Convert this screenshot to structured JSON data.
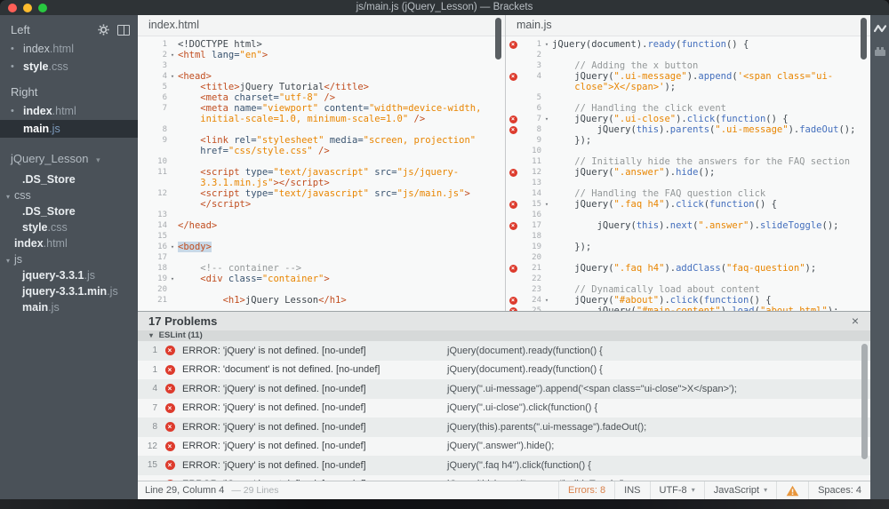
{
  "title_bar": {
    "title": "js/main.js (jQuery_Lesson) — Brackets"
  },
  "icons": {
    "dot": "•",
    "caret_down": "▾",
    "error_x": "×",
    "close": "×"
  },
  "colors": {
    "error_red": "#dd3b2d",
    "string_orange": "#e88501",
    "keyword_blue": "#446fbd",
    "tag_orange": "#c14e20",
    "warning_orange": "#e8963c"
  },
  "sidebar": {
    "working_sets": [
      {
        "label": "Left",
        "items": [
          {
            "base": "index",
            "ext": ".html",
            "dot": true,
            "bold": false,
            "selected": false
          },
          {
            "base": "style",
            "ext": ".css",
            "dot": true,
            "bold": true,
            "selected": false
          }
        ]
      },
      {
        "label": "Right",
        "items": [
          {
            "base": "index",
            "ext": ".html",
            "dot": true,
            "bold": true,
            "selected": false
          },
          {
            "base": "main",
            "ext": ".js",
            "dot": false,
            "bold": true,
            "selected": true
          }
        ]
      }
    ],
    "project": {
      "name": "jQuery_Lesson"
    },
    "tree": [
      {
        "type": "file",
        "base": ".DS_Store",
        "ext": "",
        "indent": 25
      },
      {
        "type": "folder",
        "base": "css",
        "indent": 7
      },
      {
        "type": "file",
        "base": ".DS_Store",
        "ext": "",
        "indent": 25
      },
      {
        "type": "file",
        "base": "style",
        "ext": ".css",
        "indent": 25
      },
      {
        "type": "file",
        "base": "index",
        "ext": ".html",
        "indent": 16
      },
      {
        "type": "folder",
        "base": "js",
        "indent": 7
      },
      {
        "type": "file",
        "base": "jquery-3.3.1",
        "ext": ".js",
        "indent": 25
      },
      {
        "type": "file",
        "base": "jquery-3.3.1.min",
        "ext": ".js",
        "indent": 25
      },
      {
        "type": "file",
        "base": "main",
        "ext": ".js",
        "indent": 25
      }
    ]
  },
  "editors": {
    "left": {
      "tab": "index.html",
      "rows": [
        {
          "n": "1",
          "toks": [
            [
              "pl",
              "<!DOCTYPE html>"
            ]
          ]
        },
        {
          "n": "2",
          "fold": true,
          "toks": [
            [
              "tg",
              "<html "
            ],
            [
              "at",
              "lang="
            ],
            [
              "st",
              "\"en\""
            ],
            [
              "tg",
              ">"
            ]
          ]
        },
        {
          "n": "3",
          "toks": []
        },
        {
          "n": "4",
          "fold": true,
          "toks": [
            [
              "tg",
              "<head>"
            ]
          ]
        },
        {
          "n": "5",
          "toks": [
            [
              "pl",
              "    "
            ],
            [
              "tg",
              "<title>"
            ],
            [
              "pl",
              "jQuery Tutorial"
            ],
            [
              "tg",
              "</title>"
            ]
          ]
        },
        {
          "n": "6",
          "toks": [
            [
              "pl",
              "    "
            ],
            [
              "tg",
              "<meta "
            ],
            [
              "at",
              "charset="
            ],
            [
              "st",
              "\"utf-8\""
            ],
            [
              "tg",
              " />"
            ]
          ]
        },
        {
          "n": "7",
          "toks": [
            [
              "pl",
              "    "
            ],
            [
              "tg",
              "<meta "
            ],
            [
              "at",
              "name="
            ],
            [
              "st",
              "\"viewport\""
            ],
            [
              "pl",
              " "
            ],
            [
              "at",
              "content="
            ],
            [
              "st",
              "\"width=device-width,"
            ]
          ]
        },
        {
          "n": "",
          "toks": [
            [
              "pl",
              "    "
            ],
            [
              "st",
              "initial-scale=1.0, minimum-scale=1.0\""
            ],
            [
              "tg",
              " />"
            ]
          ]
        },
        {
          "n": "8",
          "toks": []
        },
        {
          "n": "9",
          "toks": [
            [
              "pl",
              "    "
            ],
            [
              "tg",
              "<link "
            ],
            [
              "at",
              "rel="
            ],
            [
              "st",
              "\"stylesheet\""
            ],
            [
              "pl",
              " "
            ],
            [
              "at",
              "media="
            ],
            [
              "st",
              "\"screen, projection\""
            ]
          ]
        },
        {
          "n": "",
          "toks": [
            [
              "pl",
              "    "
            ],
            [
              "at",
              "href="
            ],
            [
              "st",
              "\"css/style.css\""
            ],
            [
              "tg",
              " />"
            ]
          ]
        },
        {
          "n": "10",
          "toks": []
        },
        {
          "n": "11",
          "toks": [
            [
              "pl",
              "    "
            ],
            [
              "tg",
              "<script "
            ],
            [
              "at",
              "type="
            ],
            [
              "st",
              "\"text/javascript\""
            ],
            [
              "pl",
              " "
            ],
            [
              "at",
              "src="
            ],
            [
              "st",
              "\"js/jquery-"
            ]
          ]
        },
        {
          "n": "",
          "toks": [
            [
              "pl",
              "    "
            ],
            [
              "st",
              "3.3.1.min.js\""
            ],
            [
              "tg",
              "></script>"
            ]
          ]
        },
        {
          "n": "12",
          "toks": [
            [
              "pl",
              "    "
            ],
            [
              "tg",
              "<script "
            ],
            [
              "at",
              "type="
            ],
            [
              "st",
              "\"text/javascript\""
            ],
            [
              "pl",
              " "
            ],
            [
              "at",
              "src="
            ],
            [
              "st",
              "\"js/main.js\""
            ],
            [
              "tg",
              ">"
            ]
          ]
        },
        {
          "n": "",
          "toks": [
            [
              "pl",
              "    "
            ],
            [
              "tg",
              "</script>"
            ]
          ]
        },
        {
          "n": "13",
          "toks": []
        },
        {
          "n": "14",
          "toks": [
            [
              "tg",
              "</head>"
            ]
          ]
        },
        {
          "n": "15",
          "toks": []
        },
        {
          "n": "16",
          "fold": true,
          "toks": [
            [
              "hl",
              "<body>"
            ]
          ]
        },
        {
          "n": "17",
          "toks": []
        },
        {
          "n": "18",
          "toks": [
            [
              "pl",
              "    "
            ],
            [
              "cm",
              "<!-- container -->"
            ]
          ]
        },
        {
          "n": "19",
          "fold": true,
          "toks": [
            [
              "pl",
              "    "
            ],
            [
              "tg",
              "<div "
            ],
            [
              "at",
              "class="
            ],
            [
              "st",
              "\"container\""
            ],
            [
              "tg",
              ">"
            ]
          ]
        },
        {
          "n": "20",
          "toks": []
        },
        {
          "n": "21",
          "toks": [
            [
              "pl",
              "        "
            ],
            [
              "tg",
              "<h1>"
            ],
            [
              "pl",
              "jQuery Lesson"
            ],
            [
              "tg",
              "</h1>"
            ]
          ]
        }
      ]
    },
    "right": {
      "tab": "main.js",
      "rows": [
        {
          "n": "1",
          "fold": true,
          "err": true,
          "toks": [
            [
              "pl",
              "jQuery(document)."
            ],
            [
              "pr",
              "ready"
            ],
            [
              "pl",
              "("
            ],
            [
              "kw",
              "function"
            ],
            [
              "pl",
              "() {"
            ]
          ]
        },
        {
          "n": "2",
          "toks": []
        },
        {
          "n": "3",
          "toks": [
            [
              "pl",
              "    "
            ],
            [
              "cm",
              "// Adding the x button"
            ]
          ]
        },
        {
          "n": "4",
          "err": true,
          "toks": [
            [
              "pl",
              "    jQuery("
            ],
            [
              "st",
              "\".ui-message\""
            ],
            [
              "pl",
              ")."
            ],
            [
              "pr",
              "append"
            ],
            [
              "pl",
              "("
            ],
            [
              "st",
              "'<span class=\"ui-"
            ]
          ]
        },
        {
          "n": "",
          "toks": [
            [
              "pl",
              "    "
            ],
            [
              "st",
              "close\">X</span>'"
            ],
            [
              "pl",
              ");"
            ]
          ]
        },
        {
          "n": "5",
          "toks": []
        },
        {
          "n": "6",
          "toks": [
            [
              "pl",
              "    "
            ],
            [
              "cm",
              "// Handling the click event"
            ]
          ]
        },
        {
          "n": "7",
          "fold": true,
          "err": true,
          "toks": [
            [
              "pl",
              "    jQuery("
            ],
            [
              "st",
              "\".ui-close\""
            ],
            [
              "pl",
              ")."
            ],
            [
              "pr",
              "click"
            ],
            [
              "pl",
              "("
            ],
            [
              "kw",
              "function"
            ],
            [
              "pl",
              "() {"
            ]
          ]
        },
        {
          "n": "8",
          "err": true,
          "toks": [
            [
              "pl",
              "        jQuery("
            ],
            [
              "kw",
              "this"
            ],
            [
              "pl",
              ")."
            ],
            [
              "pr",
              "parents"
            ],
            [
              "pl",
              "("
            ],
            [
              "st",
              "\".ui-message\""
            ],
            [
              "pl",
              ")."
            ],
            [
              "pr",
              "fadeOut"
            ],
            [
              "pl",
              "();"
            ]
          ]
        },
        {
          "n": "9",
          "toks": [
            [
              "pl",
              "    });"
            ]
          ]
        },
        {
          "n": "10",
          "toks": []
        },
        {
          "n": "11",
          "toks": [
            [
              "pl",
              "    "
            ],
            [
              "cm",
              "// Initially hide the answers for the FAQ section"
            ]
          ]
        },
        {
          "n": "12",
          "err": true,
          "toks": [
            [
              "pl",
              "    jQuery("
            ],
            [
              "st",
              "\".answer\""
            ],
            [
              "pl",
              ")."
            ],
            [
              "pr",
              "hide"
            ],
            [
              "pl",
              "();"
            ]
          ]
        },
        {
          "n": "13",
          "toks": []
        },
        {
          "n": "14",
          "toks": [
            [
              "pl",
              "    "
            ],
            [
              "cm",
              "// Handling the FAQ question click"
            ]
          ]
        },
        {
          "n": "15",
          "fold": true,
          "err": true,
          "toks": [
            [
              "pl",
              "    jQuery("
            ],
            [
              "st",
              "\".faq h4\""
            ],
            [
              "pl",
              ")."
            ],
            [
              "pr",
              "click"
            ],
            [
              "pl",
              "("
            ],
            [
              "kw",
              "function"
            ],
            [
              "pl",
              "() {"
            ]
          ]
        },
        {
          "n": "16",
          "toks": []
        },
        {
          "n": "17",
          "err": true,
          "toks": [
            [
              "pl",
              "        jQuery("
            ],
            [
              "kw",
              "this"
            ],
            [
              "pl",
              ")."
            ],
            [
              "pr",
              "next"
            ],
            [
              "pl",
              "("
            ],
            [
              "st",
              "\".answer\""
            ],
            [
              "pl",
              ")."
            ],
            [
              "pr",
              "slideToggle"
            ],
            [
              "pl",
              "();"
            ]
          ]
        },
        {
          "n": "18",
          "toks": []
        },
        {
          "n": "19",
          "toks": [
            [
              "pl",
              "    });"
            ]
          ]
        },
        {
          "n": "20",
          "toks": []
        },
        {
          "n": "21",
          "err": true,
          "toks": [
            [
              "pl",
              "    jQuery("
            ],
            [
              "st",
              "\".faq h4\""
            ],
            [
              "pl",
              ")."
            ],
            [
              "pr",
              "addClass"
            ],
            [
              "pl",
              "("
            ],
            [
              "st",
              "\"faq-question\""
            ],
            [
              "pl",
              ");"
            ]
          ]
        },
        {
          "n": "22",
          "toks": []
        },
        {
          "n": "23",
          "toks": [
            [
              "pl",
              "    "
            ],
            [
              "cm",
              "// Dynamically load about content"
            ]
          ]
        },
        {
          "n": "24",
          "fold": true,
          "err": true,
          "toks": [
            [
              "pl",
              "    jQuery("
            ],
            [
              "st",
              "\"#about\""
            ],
            [
              "pl",
              ")."
            ],
            [
              "pr",
              "click"
            ],
            [
              "pl",
              "("
            ],
            [
              "kw",
              "function"
            ],
            [
              "pl",
              "() {"
            ]
          ]
        },
        {
          "n": "25",
          "err": true,
          "toks": [
            [
              "pl",
              "        jQuery("
            ],
            [
              "st",
              "\"#main-content\""
            ],
            [
              "pl",
              ")."
            ],
            [
              "pr",
              "load"
            ],
            [
              "pl",
              "("
            ],
            [
              "st",
              "\"about.html\""
            ],
            [
              "pl",
              ");"
            ]
          ]
        }
      ]
    }
  },
  "problems": {
    "title": "17 Problems",
    "close_label": "×",
    "section": "ESLint (11)",
    "rows": [
      {
        "line": "1",
        "message": "ERROR: 'jQuery' is not defined. [no-undef]",
        "code": "jQuery(document).ready(function() {"
      },
      {
        "line": "1",
        "message": "ERROR: 'document' is not defined. [no-undef]",
        "code": "jQuery(document).ready(function() {"
      },
      {
        "line": "4",
        "message": "ERROR: 'jQuery' is not defined. [no-undef]",
        "code": "jQuery(\".ui-message\").append('<span class=\"ui-close\">X</span>');"
      },
      {
        "line": "7",
        "message": "ERROR: 'jQuery' is not defined. [no-undef]",
        "code": "jQuery(\".ui-close\").click(function() {"
      },
      {
        "line": "8",
        "message": "ERROR: 'jQuery' is not defined. [no-undef]",
        "code": "jQuery(this).parents(\".ui-message\").fadeOut();"
      },
      {
        "line": "12",
        "message": "ERROR: 'jQuery' is not defined. [no-undef]",
        "code": "jQuery(\".answer\").hide();"
      },
      {
        "line": "15",
        "message": "ERROR: 'jQuery' is not defined. [no-undef]",
        "code": "jQuery(\".faq h4\").click(function() {"
      },
      {
        "line": "17",
        "message": "ERROR: 'jQuery' is not defined. [no-undef]",
        "code": "jQuery(this).next(\".answer\").slideToggle();"
      }
    ]
  },
  "status_bar": {
    "position": "Line 29, Column 4",
    "line_count": "— 29 Lines",
    "errors": "Errors: 8",
    "insert_mode": "INS",
    "encoding": "UTF-8",
    "language": "JavaScript",
    "indent": "Spaces: 4"
  }
}
